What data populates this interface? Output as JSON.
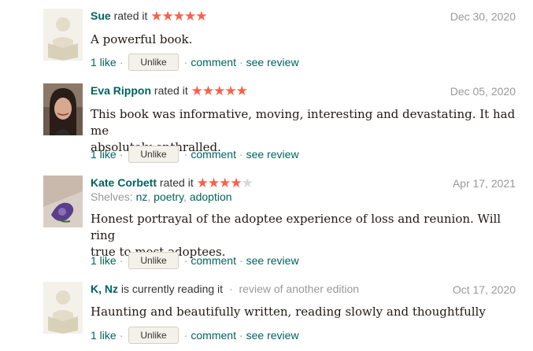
{
  "reviews": [
    {
      "user": "Sue",
      "action": "rated it",
      "stars": [
        "★",
        "★",
        "★",
        "★",
        "★"
      ],
      "date": "Dec 30, 2020",
      "text": "A powerful book.",
      "like_count": "1 like",
      "unlike_label": "Unlike",
      "comment_label": "comment",
      "see_review_label": "see review",
      "avatar": "default-reader-avatar"
    },
    {
      "user": "Eva Rippon",
      "action": "rated it",
      "stars": [
        "★",
        "★",
        "★",
        "★",
        "★"
      ],
      "date": "Dec 05, 2020",
      "text_lines": [
        "This book was informative, moving, interesting and devastating. It had me",
        "absolutely enthralled."
      ],
      "like_count": "1 like",
      "unlike_label": "Unlike",
      "comment_label": "comment",
      "see_review_label": "see review",
      "avatar": "user-photo"
    },
    {
      "user": "Kate Corbett",
      "action": "rated it",
      "stars": [
        "★",
        "★",
        "★",
        "★",
        "★"
      ],
      "rating": 4,
      "date": "Apr 17, 2021",
      "shelves_label": "Shelves:",
      "shelves": [
        "nz",
        "poetry",
        "adoption"
      ],
      "text_lines": [
        "Honest portrayal of the adoptee experience of loss and reunion. Will ring",
        "true to most adoptees."
      ],
      "like_count": "1 like",
      "unlike_label": "Unlike",
      "comment_label": "comment",
      "see_review_label": "see review",
      "avatar": "flower-photo"
    },
    {
      "user": "K, Nz",
      "action": "is currently reading it",
      "edition_note": "review of another edition",
      "date": "Oct 17, 2020",
      "text": "Haunting and beautifully written, reading slowly and thoughtfully",
      "like_count": "1 like",
      "unlike_label": "Unlike",
      "comment_label": "comment",
      "see_review_label": "see review",
      "avatar": "default-reader-avatar"
    }
  ],
  "colors": {
    "link": "#00635d",
    "star": "#fa604a",
    "star_off": "#d8d8d8",
    "muted": "#999999",
    "button_bg": "#f4f1ea"
  }
}
